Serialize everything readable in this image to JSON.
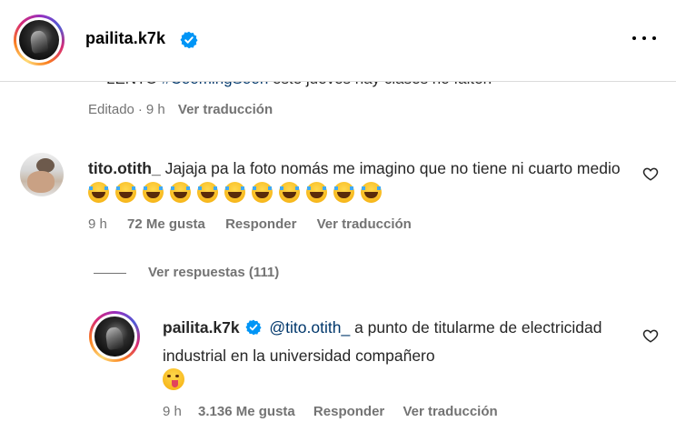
{
  "header": {
    "username": "pailita.k7k",
    "avatar_icon": "profile-photo",
    "verified_icon": "verified-badge-icon",
    "more_icon": "more-horizontal-icon"
  },
  "caption": {
    "text_prefix": "LENTO",
    "hashtag": "#CoomingSoon",
    "text_suffix": "este jueves hay clases no falten",
    "edited": "Editado",
    "time": "9 h",
    "translate": "Ver traducción"
  },
  "comment": {
    "username": "tito.otith_",
    "text": "Jajaja pa la foto nomás me imagino que no tiene ni cuarto medio",
    "emoji_count": 11,
    "emoji_name": "face-with-tears-of-joy",
    "time": "9 h",
    "likes": "72 Me gusta",
    "reply": "Responder",
    "translate": "Ver traducción",
    "like_icon": "heart-outline-icon"
  },
  "replies_toggle": {
    "label": "Ver respuestas (111)"
  },
  "reply": {
    "username": "pailita.k7k",
    "mention": "@tito.otith_",
    "text": "a punto de titularme de electricidad industrial en la universidad compañero",
    "emoji_name": "face-blowing-a-kiss-wink",
    "time": "9 h",
    "likes": "3.136 Me gusta",
    "reply": "Responder",
    "translate": "Ver traducción",
    "like_icon": "heart-outline-icon"
  },
  "colors": {
    "text": "#262626",
    "secondary": "#737373",
    "link": "#00376b",
    "verified": "#0095f6",
    "divider": "#dbdbdb"
  }
}
